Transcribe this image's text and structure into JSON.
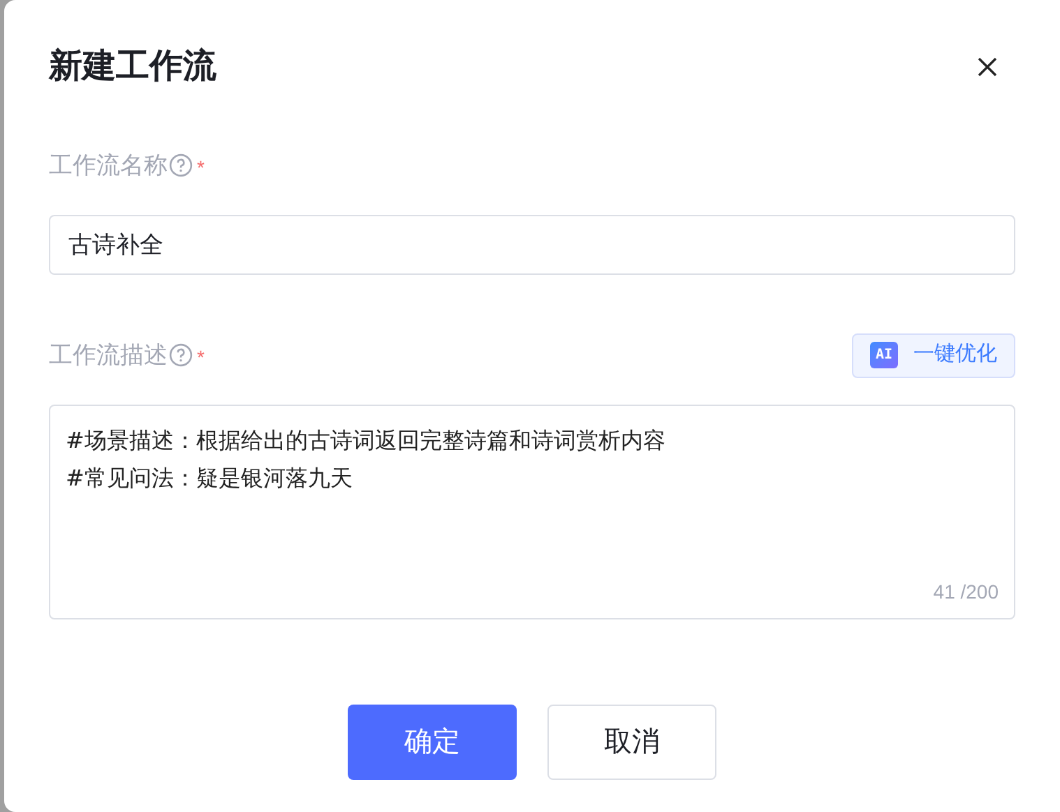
{
  "dialog": {
    "title": "新建工作流",
    "name_field": {
      "label": "工作流名称",
      "required_mark": "*",
      "value": "古诗补全"
    },
    "description_field": {
      "label": "工作流描述",
      "required_mark": "*",
      "ai_button": {
        "badge": "AI",
        "label": "一键优化"
      },
      "value": "#场景描述：根据给出的古诗词返回完整诗篇和诗词赏析内容\n#常见问法：疑是银河落九天",
      "counter": "41 /200"
    },
    "buttons": [
      {
        "label": "确定",
        "kind": "primary"
      },
      {
        "label": "取消",
        "kind": "secondary"
      }
    ]
  }
}
